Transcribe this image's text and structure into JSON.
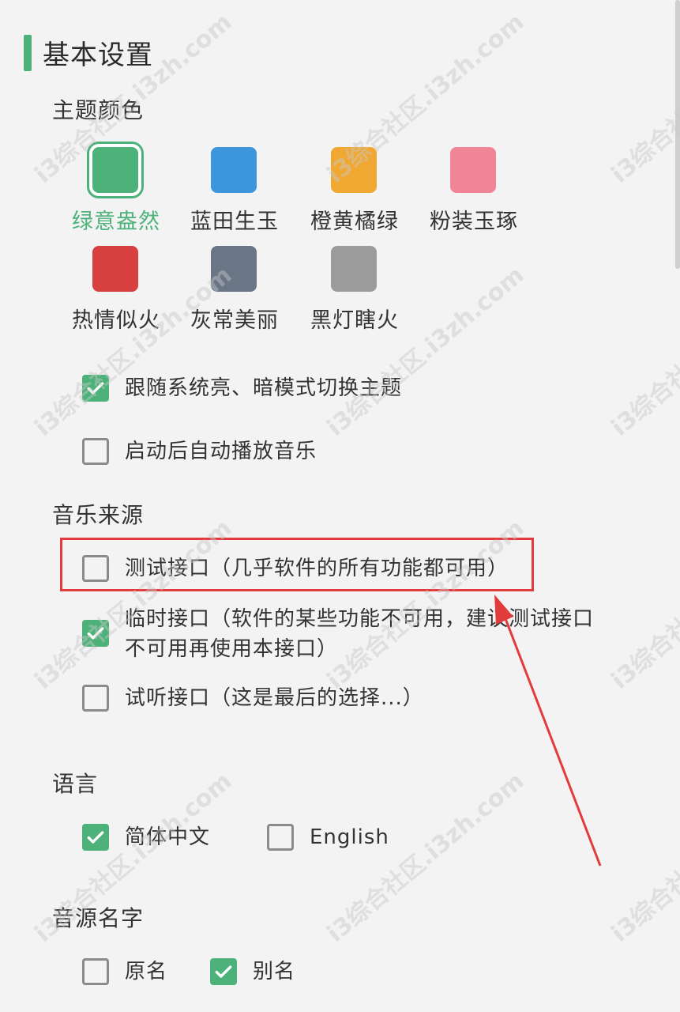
{
  "basic_settings": {
    "title": "基本设置"
  },
  "theme": {
    "label": "主题颜色",
    "swatches": [
      {
        "name": "绿意盎然",
        "color": "#4db27a",
        "selected": true
      },
      {
        "name": "蓝田生玉",
        "color": "#3d95dc",
        "selected": false
      },
      {
        "name": "橙黄橘绿",
        "color": "#f0a832",
        "selected": false
      },
      {
        "name": "粉装玉琢",
        "color": "#ef8597",
        "selected": false
      },
      {
        "name": "热情似火",
        "color": "#d8403f",
        "selected": false
      },
      {
        "name": "灰常美丽",
        "color": "#6a7585",
        "selected": false
      },
      {
        "name": "黑灯瞎火",
        "color": "#9b9b9b",
        "selected": false
      }
    ],
    "follow_system": {
      "label": "跟随系统亮、暗模式切换主题",
      "checked": true
    },
    "autoplay": {
      "label": "启动后自动播放音乐",
      "checked": false
    }
  },
  "music_source": {
    "label": "音乐来源",
    "options": [
      {
        "label": "测试接口（几乎软件的所有功能都可用）",
        "checked": false
      },
      {
        "label": "临时接口（软件的某些功能不可用，建议测试接口",
        "label_line2": "不可用再使用本接口）",
        "checked": true
      },
      {
        "label": "试听接口（这是最后的选择...）",
        "checked": false
      }
    ]
  },
  "language": {
    "label": "语言",
    "options": [
      {
        "label": "简体中文",
        "checked": true
      },
      {
        "label": "English",
        "checked": false
      }
    ]
  },
  "source_name": {
    "label": "音源名字",
    "options": [
      {
        "label": "原名",
        "checked": false
      },
      {
        "label": "别名",
        "checked": true
      }
    ]
  },
  "accent_color": "#4db27a",
  "annotation_color": "#e23b3b",
  "watermark_text": "i3综合社区.i3zh.com"
}
